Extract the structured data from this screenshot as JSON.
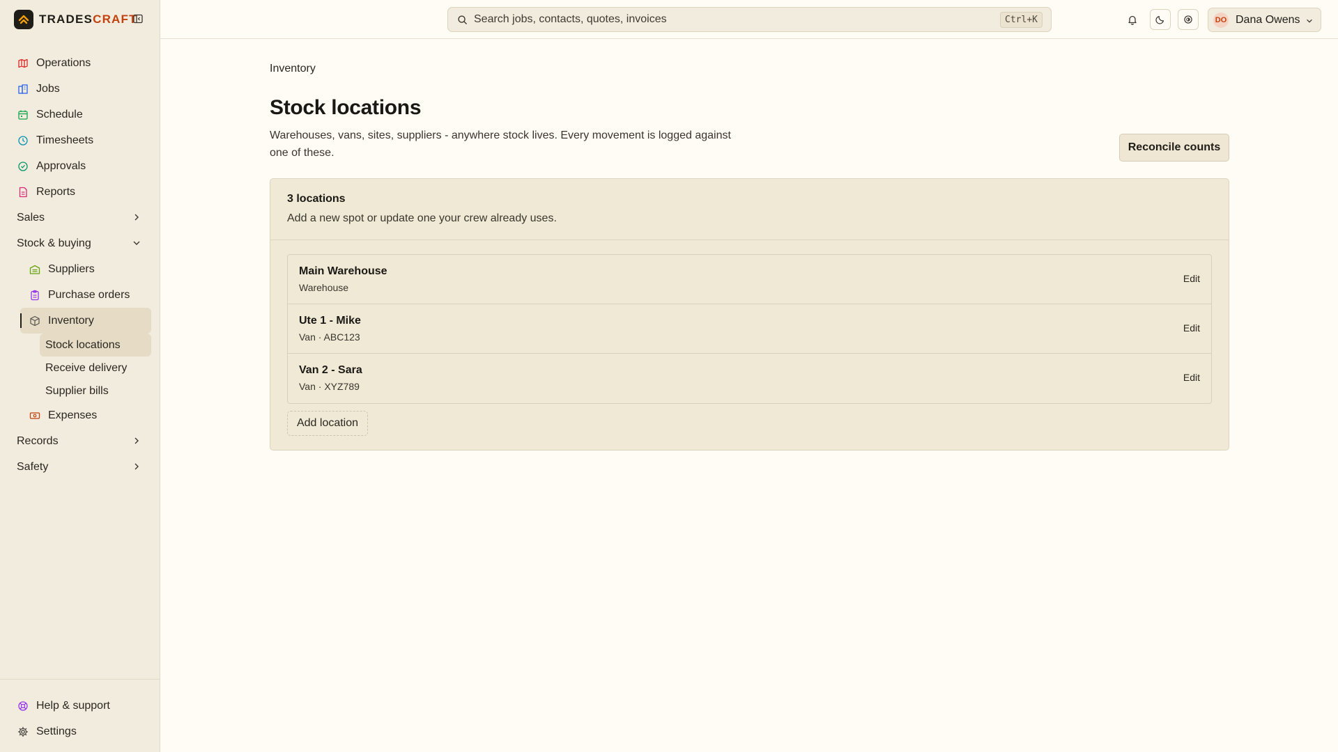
{
  "brand": {
    "name_main": "TRADES",
    "name_accent": "CRAFT",
    "accent_color": "#c2410c"
  },
  "sidebar": {
    "items": [
      {
        "label": "Operations",
        "icon": "map-icon",
        "color": "#dc2626"
      },
      {
        "label": "Jobs",
        "icon": "building-icon",
        "color": "#2563eb"
      },
      {
        "label": "Schedule",
        "icon": "calendar-icon",
        "color": "#16a34a"
      },
      {
        "label": "Timesheets",
        "icon": "clock-icon",
        "color": "#0891b2"
      },
      {
        "label": "Approvals",
        "icon": "check-circle-icon",
        "color": "#059669"
      },
      {
        "label": "Reports",
        "icon": "report-icon",
        "color": "#db2777"
      }
    ],
    "groups": {
      "sales": "Sales",
      "stock": "Stock & buying",
      "records": "Records",
      "safety": "Safety"
    },
    "stock_items": {
      "suppliers": "Suppliers",
      "purchase_orders": "Purchase orders",
      "inventory": "Inventory",
      "expenses": "Expenses"
    },
    "inventory_items": {
      "stock_locations": "Stock locations",
      "receive_delivery": "Receive delivery",
      "supplier_bills": "Supplier bills"
    },
    "footer": {
      "help": "Help & support",
      "settings": "Settings"
    }
  },
  "topbar": {
    "search_placeholder": "Search jobs, contacts, quotes, invoices",
    "shortcut": "Ctrl+K",
    "user": {
      "initials": "DO",
      "name": "Dana Owens"
    }
  },
  "page": {
    "breadcrumb": "Inventory",
    "title": "Stock locations",
    "description": "Warehouses, vans, sites, suppliers - anywhere stock lives. Every movement is logged against one of these.",
    "primary_action": "Reconcile counts"
  },
  "card": {
    "title": "3 locations",
    "subtitle": "Add a new spot or update one your crew already uses.",
    "locations": [
      {
        "name": "Main Warehouse",
        "meta": "Warehouse",
        "action": "Edit"
      },
      {
        "name": "Ute 1 - Mike",
        "meta": "Van · ABC123",
        "action": "Edit"
      },
      {
        "name": "Van 2 - Sara",
        "meta": "Van · XYZ789",
        "action": "Edit"
      }
    ],
    "add_label": "Add location"
  }
}
